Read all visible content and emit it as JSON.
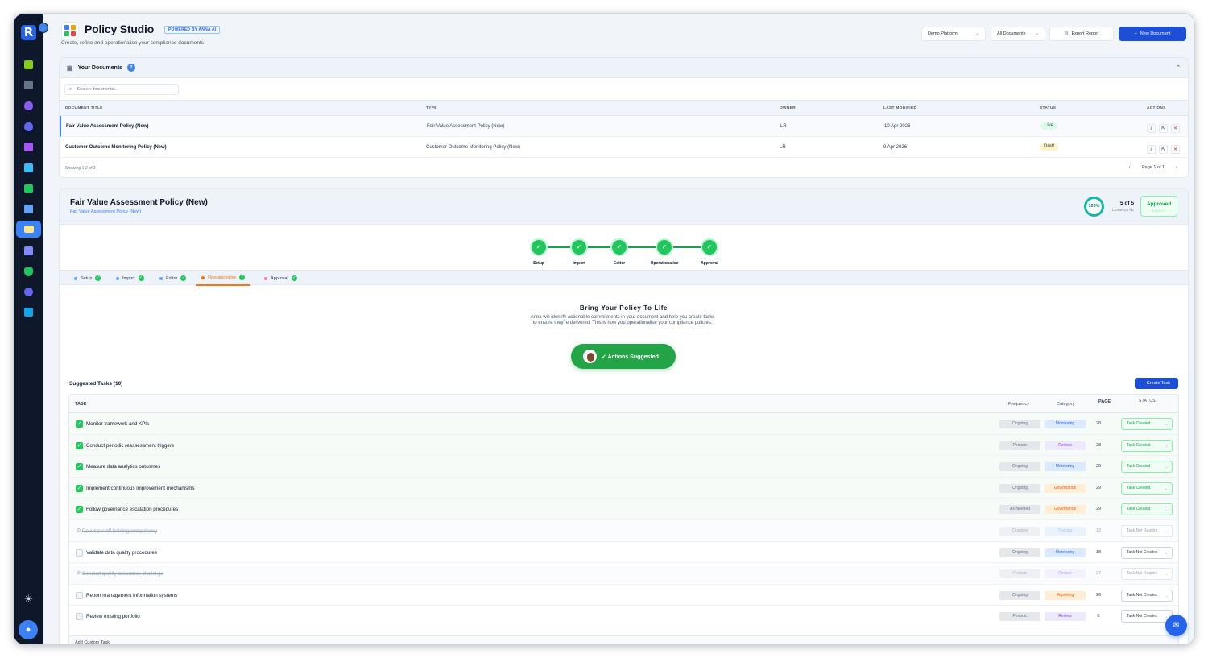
{
  "app": {
    "logo_letter": "R",
    "title": "Policy Studio",
    "powered": "POWERED BY ANNA AI",
    "subtitle": "Create, refine and operationalise your compliance documents"
  },
  "header": {
    "platform": "Demo Platform",
    "filter": "All Documents",
    "export": "Export Report",
    "new_doc": "New Document"
  },
  "documents": {
    "title": "Your Documents",
    "count": "2",
    "search_placeholder": "Search documents...",
    "columns": [
      "DOCUMENT TITLE",
      "TYPE",
      "OWNER",
      "LAST MODIFIED",
      "STATUS",
      "ACTIONS"
    ],
    "rows": [
      {
        "title": "Fair Value Assessment Policy (New)",
        "type": "Fair Value Assessment Policy (New)",
        "owner": "LR",
        "modified": "10 Apr 2026",
        "status": "Live"
      },
      {
        "title": "Customer Outcome Monitoring Policy (New)",
        "type": "Customer Outcome Monitoring Policy (New)",
        "owner": "LR",
        "modified": "9 Apr 2026",
        "status": "Draft"
      }
    ],
    "showing": "Showing 1-2 of 2",
    "page": "Page 1 of 1"
  },
  "detail": {
    "title": "Fair Value Assessment Policy (New)",
    "subtitle": "Fair Value Assessment Policy (New)",
    "progress": "100%",
    "steps_done": "5 of 5",
    "complete_label": "COMPLETE",
    "status": "Approved",
    "status_label": "STATUS",
    "steps": [
      "Setup",
      "Import",
      "Editor",
      "Operationalise",
      "Approval"
    ],
    "active_tab": "Operationalise",
    "bring_title": "Bring Your Policy To Life",
    "bring_desc": "Anna will identify actionable commitments in your document and help you create tasks to ensure they're delivered. This is how you operationalise your compliance policies.",
    "suggest_button": "✓ Actions Suggested"
  },
  "tasks": {
    "title": "Suggested Tasks (10)",
    "create": "Create Task",
    "columns": [
      "TASK",
      "Frequency",
      "Category",
      "PAGE",
      "STATUS"
    ],
    "rows": [
      {
        "name": "Monitor framework and KPIs",
        "freq": "Ongoing",
        "cat": "Monitoring",
        "page": "28",
        "status": "Task Created",
        "state": "done"
      },
      {
        "name": "Conduct periodic reassessment triggers",
        "freq": "Periodic",
        "cat": "Review",
        "page": "28",
        "status": "Task Created",
        "state": "done"
      },
      {
        "name": "Measure data analytics outcomes",
        "freq": "Ongoing",
        "cat": "Monitoring",
        "page": "29",
        "status": "Task Created",
        "state": "done"
      },
      {
        "name": "Implement continuous improvement mechanisms",
        "freq": "Ongoing",
        "cat": "Governance",
        "page": "29",
        "status": "Task Created",
        "state": "done"
      },
      {
        "name": "Follow governance escalation procedures",
        "freq": "As-Needed",
        "cat": "Governance",
        "page": "29",
        "status": "Task Created",
        "state": "done"
      },
      {
        "name": "Develop staff training competency",
        "freq": "Ongoing",
        "cat": "Training",
        "page": "32",
        "status": "Task Not Require",
        "state": "skip"
      },
      {
        "name": "Validate data quality procedures",
        "freq": "Ongoing",
        "cat": "Monitoring",
        "page": "18",
        "status": "Task Not Createc",
        "state": "open"
      },
      {
        "name": "Conduct quality assurance challenge",
        "freq": "Periodic",
        "cat": "Review",
        "page": "27",
        "status": "Task Not Require",
        "state": "skip"
      },
      {
        "name": "Report management information systems",
        "freq": "Ongoing",
        "cat": "Reporting",
        "page": "26",
        "status": "Task Not Createc",
        "state": "open"
      },
      {
        "name": "Review existing portfolio",
        "freq": "Periodic",
        "cat": "Review",
        "page": "6",
        "status": "Task Not Createc",
        "state": "open"
      }
    ],
    "add_custom": "Add Custom Task"
  }
}
